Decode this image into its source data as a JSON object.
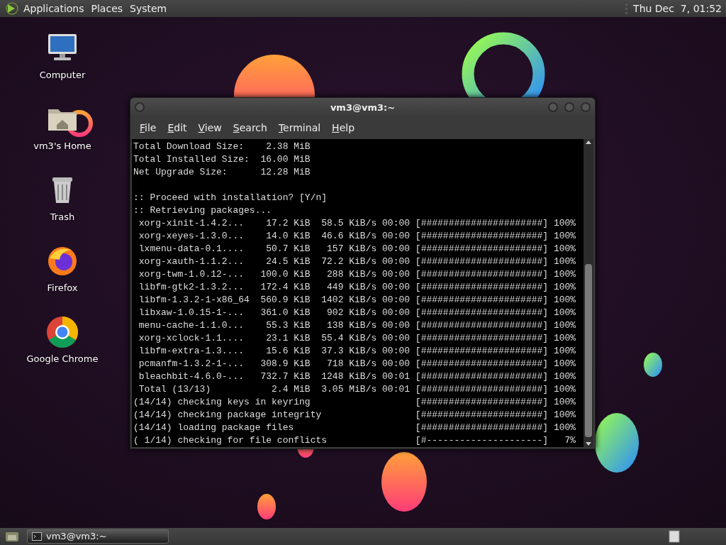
{
  "top_panel": {
    "menus": [
      "Applications",
      "Places",
      "System"
    ],
    "clock": "Thu Dec  7, 01:52"
  },
  "desktop_icons": [
    {
      "label": "Computer",
      "kind": "computer"
    },
    {
      "label": "vm3's Home",
      "kind": "folder"
    },
    {
      "label": "Trash",
      "kind": "trash"
    },
    {
      "label": "Firefox",
      "kind": "orb"
    },
    {
      "label": "Google Chrome",
      "kind": "tricolor"
    }
  ],
  "terminal": {
    "title": "vm3@vm3:~",
    "menu": [
      "File",
      "Edit",
      "View",
      "Search",
      "Terminal",
      "Help"
    ],
    "lines": [
      "Total Download Size:    2.38 MiB",
      "Total Installed Size:  16.00 MiB",
      "Net Upgrade Size:      12.28 MiB",
      ":: Proceed with installation? [Y/n]",
      ":: Retrieving packages...",
      " xorg-xinit-1.4.2...    17.2 KiB  58.5 KiB/s 00:00 [######################] 100%",
      " xorg-xeyes-1.3.0...    14.0 KiB  46.6 KiB/s 00:00 [######################] 100%",
      " lxmenu-data-0.1....    50.7 KiB   157 KiB/s 00:00 [######################] 100%",
      " xorg-xauth-1.1.2...    24.5 KiB  72.2 KiB/s 00:00 [######################] 100%",
      " xorg-twm-1.0.12-...   100.0 KiB   288 KiB/s 00:00 [######################] 100%",
      " libfm-gtk2-1.3.2...   172.4 KiB   449 KiB/s 00:00 [######################] 100%",
      " libfm-1.3.2-1-x86_64  560.9 KiB  1402 KiB/s 00:00 [######################] 100%",
      " libxaw-1.0.15-1-...   361.0 KiB   902 KiB/s 00:00 [######################] 100%",
      " menu-cache-1.1.0...    55.3 KiB   138 KiB/s 00:00 [######################] 100%",
      " xorg-xclock-1.1....    23.1 KiB  55.4 KiB/s 00:00 [######################] 100%",
      " libfm-extra-1.3....    15.6 KiB  37.3 KiB/s 00:00 [######################] 100%",
      " pcmanfm-1.3.2-1-...   308.9 KiB   718 KiB/s 00:00 [######################] 100%",
      " bleachbit-4.6.0-...   732.7 KiB  1248 KiB/s 00:01 [######################] 100%",
      " Total (13/13)           2.4 MiB  3.05 MiB/s 00:01 [######################] 100%",
      "(14/14) checking keys in keyring                   [######################] 100%",
      "(14/14) checking package integrity                 [######################] 100%",
      "(14/14) loading package files                      [######################] 100%",
      "( 1/14) checking for file conflicts                [#---------------------]   7%"
    ]
  },
  "taskbar": {
    "tasks": [
      {
        "label": "vm3@vm3:~",
        "selected": true
      }
    ]
  }
}
